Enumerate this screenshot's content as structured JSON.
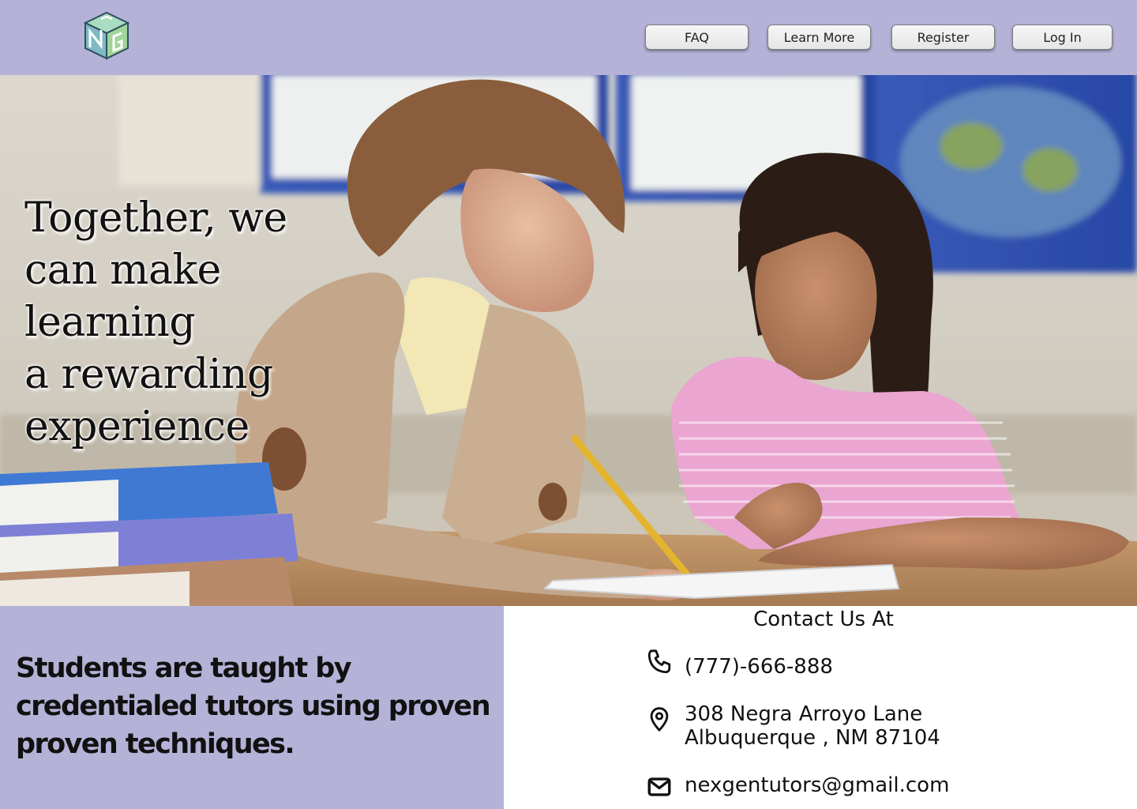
{
  "header": {
    "logo": {
      "icon": "ng-cube-logo-icon",
      "letters": "NG",
      "colors": [
        "#6fb7a3",
        "#9ad1b9",
        "#8fd4a0"
      ]
    },
    "nav": [
      {
        "label": "FAQ"
      },
      {
        "label": "Learn More"
      },
      {
        "label": "Register"
      },
      {
        "label": "Log In"
      }
    ],
    "background": "#b5b2d8"
  },
  "hero": {
    "headline_lines": [
      "Together, we",
      "can make",
      "learning",
      "a rewarding",
      "experience"
    ],
    "image": "tutor-and-student-photo"
  },
  "info": {
    "tagline": "Students are taught by credentialed tutors using proven proven techniques."
  },
  "contact": {
    "title": "Contact Us At",
    "phone": {
      "icon": "phone-icon",
      "text": "(777)-666-888"
    },
    "address": {
      "icon": "location-pin-icon",
      "line1": "308 Negra Arroyo Lane",
      "line2": "Albuquerque , NM 87104"
    },
    "email": {
      "icon": "mail-icon",
      "text": "nexgentutors@gmail.com"
    }
  }
}
